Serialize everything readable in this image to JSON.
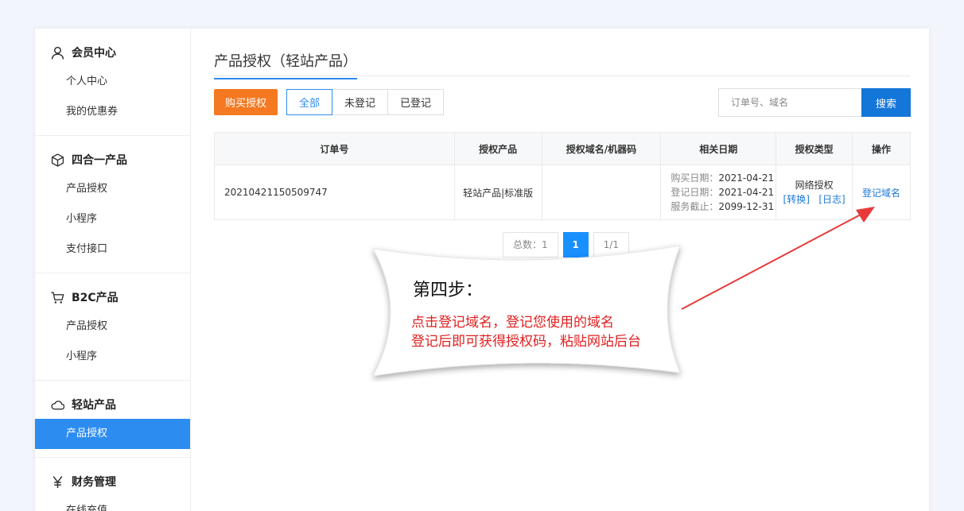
{
  "sidebar": {
    "groups": [
      {
        "title": "会员中心",
        "icon": "user-icon",
        "items": [
          "个人中心",
          "我的优惠券"
        ]
      },
      {
        "title": "四合一产品",
        "icon": "cube-icon",
        "items": [
          "产品授权",
          "小程序",
          "支付接口"
        ]
      },
      {
        "title": "B2C产品",
        "icon": "cart-icon",
        "items": [
          "产品授权",
          "小程序"
        ]
      },
      {
        "title": "轻站产品",
        "icon": "cloud-icon",
        "items": [
          "产品授权"
        ]
      },
      {
        "title": "财务管理",
        "icon": "yen-icon",
        "items": [
          "在线充值"
        ]
      }
    ],
    "active_item": "轻站产品/产品授权"
  },
  "main": {
    "page_title": "产品授权（轻站产品）",
    "buy_label": "购买授权",
    "filters": [
      "全部",
      "未登记",
      "已登记"
    ],
    "search_placeholder": "订单号、域名",
    "search_label": "搜索",
    "table": {
      "headers": [
        "订单号",
        "授权产品",
        "授权域名/机器码",
        "相关日期",
        "授权类型",
        "操作"
      ],
      "rows": [
        {
          "order_no": "20210421150509747",
          "product": "轻站产品|标准版",
          "domain": "",
          "dates": [
            {
              "k": "购买日期：",
              "v": "2021-04-21"
            },
            {
              "k": "登记日期：",
              "v": "2021-04-21"
            },
            {
              "k": "服务截止：",
              "v": "2099-12-31"
            }
          ],
          "type": "网络授权",
          "type_links": [
            "[转换]",
            "[日志]"
          ],
          "action": "登记域名"
        }
      ]
    },
    "pager": {
      "total": "总数：1",
      "current": "1",
      "pages": "1/1"
    }
  },
  "annotation": {
    "title": "第四步：",
    "lines": [
      "点击登记域名，登记您使用的域名",
      "登记后即可获得授权码，粘贴网站后台"
    ],
    "arrow_color": "#e83a3a"
  }
}
